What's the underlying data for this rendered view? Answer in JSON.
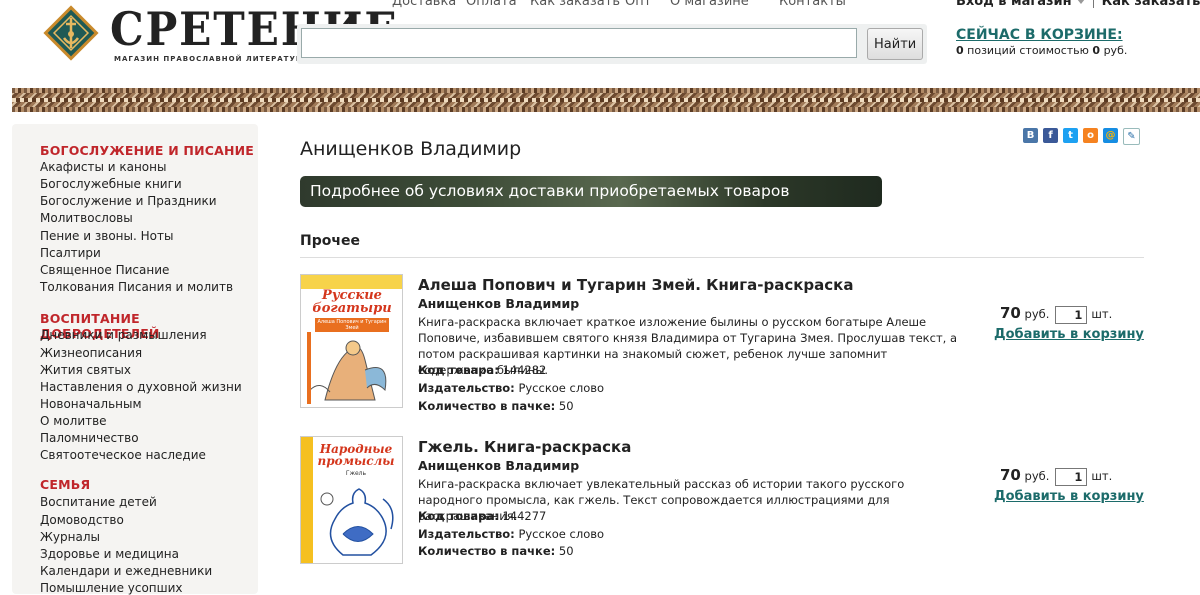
{
  "brand": {
    "logo_text": "СРЕТЕНИЕ",
    "tagline": "МАГАЗИН ПРАВОСЛАВНОЙ ЛИТЕРАТУРЫ"
  },
  "topnav": [
    "Доставка",
    "Оплата",
    "Как заказать",
    "Опт",
    "О магазине",
    "Контакты"
  ],
  "account": {
    "login": "Вход в магазин",
    "how_to_order": "Как заказать"
  },
  "search": {
    "value": "",
    "button": "Найти"
  },
  "cart": {
    "title": "СЕЙЧАС В КОРЗИНЕ:",
    "count": "0",
    "count_label": "позиций стоимостью",
    "total": "0",
    "currency": "руб."
  },
  "sidebar": [
    {
      "heading": "БОГОСЛУЖЕНИЕ И ПИСАНИЕ",
      "items": [
        "Акафисты и каноны",
        "Богослужебные книги",
        "Богослужение и Праздники",
        "Молитвословы",
        "Пение и звоны. Ноты",
        "Псалтири",
        "Священное Писание",
        "Толкования Писания и молитв"
      ]
    },
    {
      "heading": "ВОСПИТАНИЕ ДОБРОДЕТЕЛЕЙ",
      "items": [
        "Дневники и размышления",
        "Жизнеописания",
        "Жития святых",
        "Наставления о духовной жизни",
        "Новоначальным",
        "О молитве",
        "Паломничество",
        "Святоотеческое наследие"
      ]
    },
    {
      "heading": "СЕМЬЯ",
      "items": [
        "Воспитание детей",
        "Домоводство",
        "Журналы",
        "Здоровье и медицина",
        "Календари и ежедневники",
        "Помышление усопших"
      ]
    }
  ],
  "page_title": "Анищенков Владимир",
  "share_icons": [
    "vk-icon",
    "facebook-icon",
    "twitter-icon",
    "odnoklassniki-icon",
    "mail-icon",
    "livejournal-icon"
  ],
  "delivery_banner": "Подробнее об условиях доставки приобретаемых товаров",
  "section_title": "Прочее",
  "labels": {
    "code": "Код товара:",
    "publisher": "Издательство:",
    "pack": "Количество в пачке:",
    "rub": "руб.",
    "pcs": "шт.",
    "add": "Добавить в корзину"
  },
  "products": [
    {
      "title": "Алеша Попович и Тугарин Змей. Книга-раскраска",
      "author": "Анищенков Владимир",
      "description": "Книга-раскраска включает краткое изложение былины о русском богатыре Алеше Поповиче, избавившем святого князя Владимира от Тугарина Змея. Прослушав текст, а потом раскрашивая картинки на знакомый сюжет, ребенок лучше запомнит содержание былины.",
      "code": "144282",
      "publisher": "Русское слово",
      "pack": "50",
      "price": "70",
      "qty": "1",
      "cover_title": "Русские богатыри",
      "cover_sub": "Алеша Попович и Тугарин Змей"
    },
    {
      "title": "Гжель. Книга-раскраска",
      "author": "Анищенков Владимир",
      "description": "Книга-раскраска включает увлекательный рассказ об истории такого русского народного промысла, как гжель. Текст сопровождается иллюстрациями для раскрашивания.",
      "code": "144277",
      "publisher": "Русское слово",
      "pack": "50",
      "price": "70",
      "qty": "1",
      "cover_title": "Народные промыслы",
      "cover_sub": "Гжель"
    }
  ]
}
